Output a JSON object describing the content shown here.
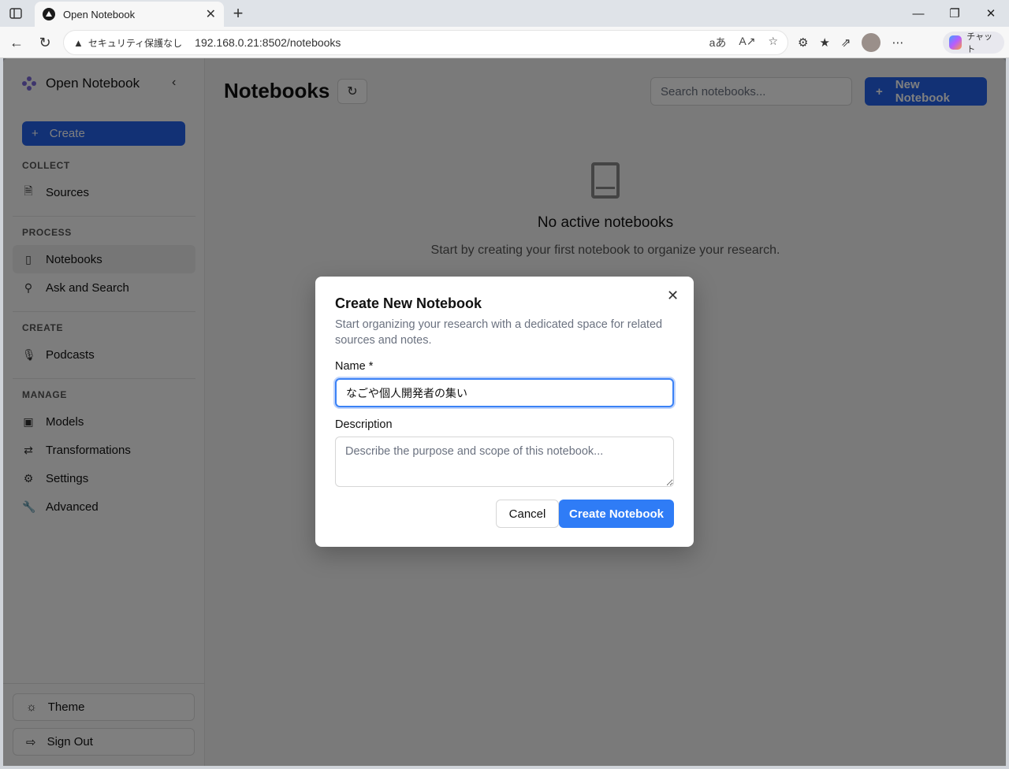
{
  "browser": {
    "tab_title": "Open Notebook",
    "tab_close": "✕",
    "new_tab": "+",
    "security_label": "セキュリティ保護なし",
    "url": "192.168.0.21:8502/notebooks",
    "chat_label": "チャット"
  },
  "sidebar": {
    "brand": "Open Notebook",
    "create_label": "Create",
    "sections": {
      "collect": "COLLECT",
      "process": "PROCESS",
      "create": "CREATE",
      "manage": "MANAGE"
    },
    "items": {
      "sources": "Sources",
      "notebooks": "Notebooks",
      "ask": "Ask and Search",
      "podcasts": "Podcasts",
      "models": "Models",
      "transformations": "Transformations",
      "settings": "Settings",
      "advanced": "Advanced"
    },
    "theme_label": "Theme",
    "signout_label": "Sign Out"
  },
  "header": {
    "title": "Notebooks",
    "search_placeholder": "Search notebooks...",
    "new_notebook_label": "New Notebook"
  },
  "empty_state": {
    "title": "No active notebooks",
    "subtitle": "Start by creating your first notebook to organize your research."
  },
  "dialog": {
    "title": "Create New Notebook",
    "description": "Start organizing your research with a dedicated space for related sources and notes.",
    "name_label": "Name *",
    "name_value": "なごや個人開発者の集い",
    "description_label": "Description",
    "description_placeholder": "Describe the purpose and scope of this notebook...",
    "cancel_label": "Cancel",
    "submit_label": "Create Notebook"
  },
  "colors": {
    "accent": "#2563eb",
    "submit": "#2f7cf6",
    "focus_ring": "#3b82f6"
  }
}
